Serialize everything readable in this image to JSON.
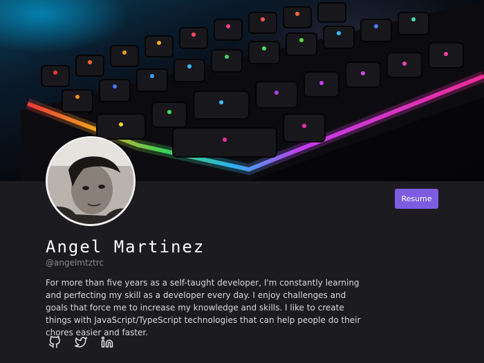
{
  "profile": {
    "name": "Angel Martinez",
    "handle": "@angelmtztrc",
    "bio": "For more than five years as a self-taught developer, I'm constantly learning and perfecting my skill as a developer every day. I enjoy challenges and goals that force me to increase my knowledge and skills. I like to create things with JavaScript/TypeScript technologies that can help people do their chores easier and faster."
  },
  "actions": {
    "resume_label": "Resume"
  },
  "socials": [
    {
      "icon": "github-icon"
    },
    {
      "icon": "twitter-icon"
    },
    {
      "icon": "linkedin-icon"
    }
  ],
  "colors": {
    "background": "#1c1b1f",
    "accent": "#7c5ce0"
  }
}
